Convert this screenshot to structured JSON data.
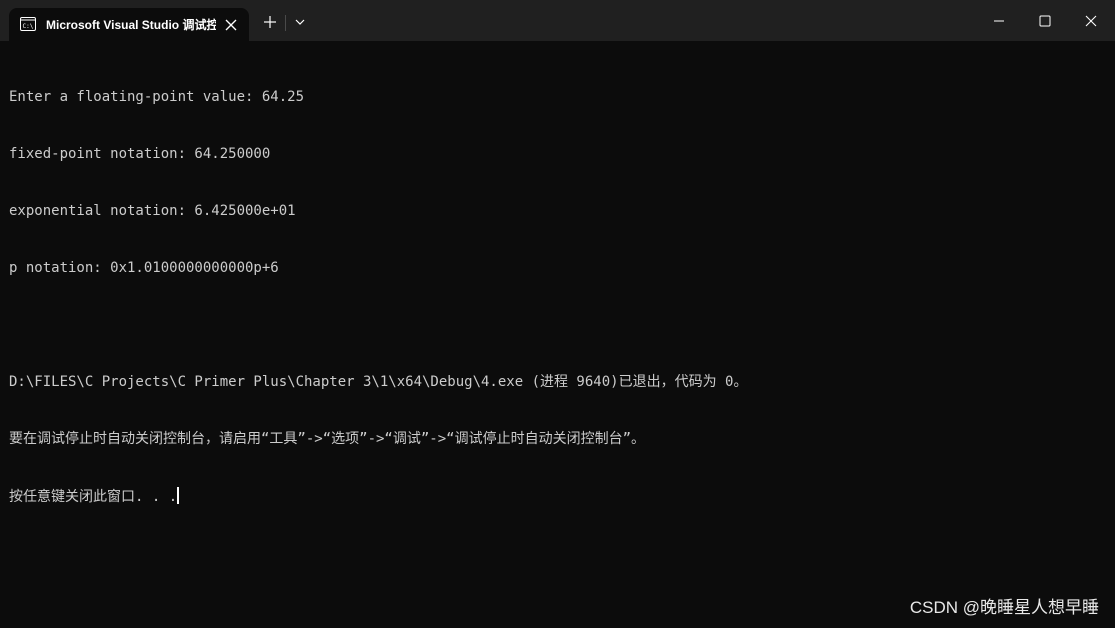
{
  "tab": {
    "icon": "terminal-icon",
    "title": "Microsoft Visual Studio 调试控制台"
  },
  "titlebar": {
    "new_tab_icon": "plus-icon",
    "dropdown_icon": "chevron-down-icon",
    "minimize_icon": "minimize-icon",
    "maximize_icon": "maximize-icon",
    "close_icon": "close-icon"
  },
  "console": {
    "lines": [
      "Enter a floating-point value: 64.25",
      "fixed-point notation: 64.250000",
      "exponential notation: 6.425000e+01",
      "p notation: 0x1.0100000000000p+6",
      "",
      "D:\\FILES\\C Projects\\C Primer Plus\\Chapter 3\\1\\x64\\Debug\\4.exe (进程 9640)已退出，代码为 0。",
      "要在调试停止时自动关闭控制台，请启用“工具”->“选项”->“调试”->“调试停止时自动关闭控制台”。",
      "按任意键关闭此窗口. . ."
    ]
  },
  "watermark": "CSDN @晚睡星人想早睡",
  "colors": {
    "background": "#0c0c0c",
    "titlebar": "#202020",
    "text": "#cccccc"
  }
}
